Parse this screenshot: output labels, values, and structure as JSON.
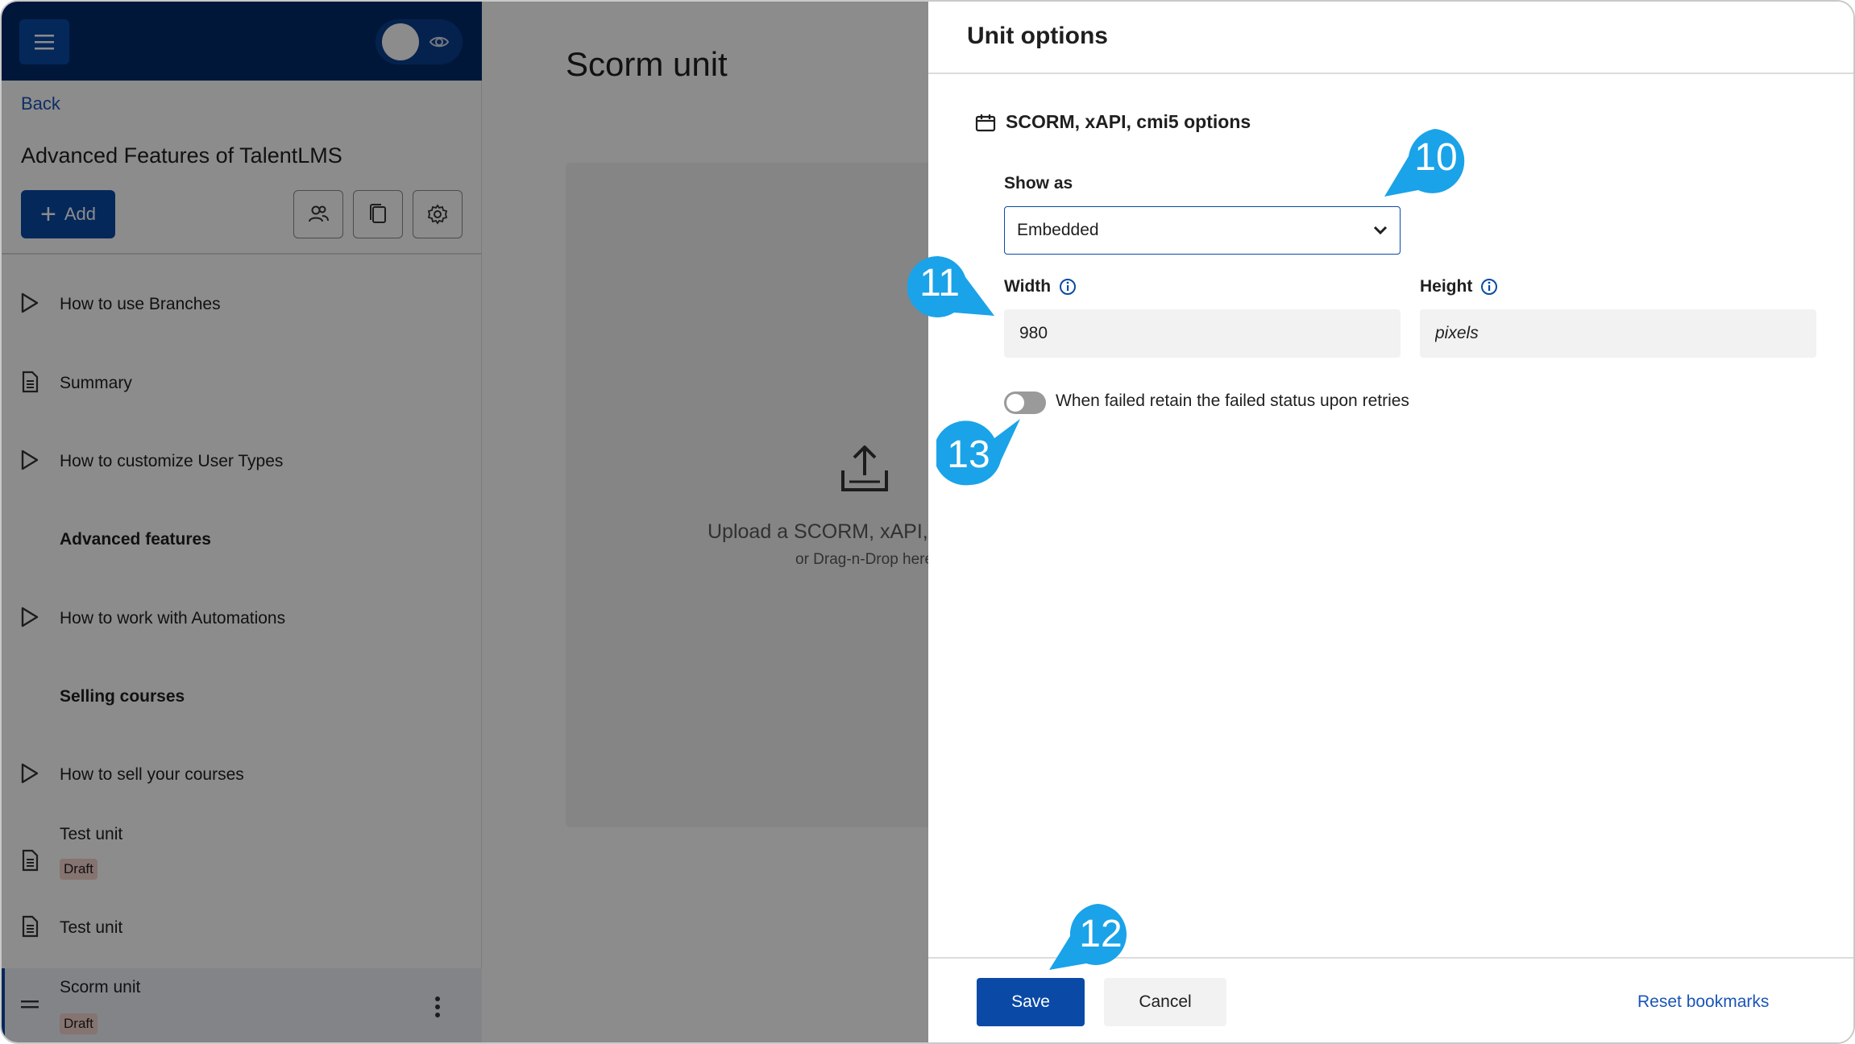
{
  "sidebar": {
    "back_label": "Back",
    "course_title": "Advanced Features of TalentLMS",
    "add_label": "Add",
    "items": [
      {
        "label": "How to use Branches",
        "icon": "play-icon"
      },
      {
        "label": "Summary",
        "icon": "document-icon"
      },
      {
        "label": "How to customize User Types",
        "icon": "play-icon"
      },
      {
        "label": "Advanced features",
        "type": "section"
      },
      {
        "label": "How to work with Automations",
        "icon": "play-icon"
      },
      {
        "label": "Selling courses",
        "type": "section"
      },
      {
        "label": "How to sell your courses",
        "icon": "play-icon"
      },
      {
        "label": "Test unit",
        "icon": "document-icon",
        "badge": "Draft"
      },
      {
        "label": "Test unit",
        "icon": "document-icon"
      },
      {
        "label": "Scorm unit",
        "icon": "drag-handle-icon",
        "badge": "Draft",
        "active": true
      }
    ]
  },
  "main": {
    "title": "Scorm unit",
    "upload_text": "Upload a SCORM, xAPI, c",
    "upload_sub": "or Drag-n-Drop here"
  },
  "drawer": {
    "title": "Unit options",
    "section_title": "SCORM, xAPI, cmi5 options",
    "show_as_label": "Show as",
    "show_as_value": "Embedded",
    "width_label": "Width",
    "width_value": "980",
    "height_label": "Height",
    "height_placeholder": "pixels",
    "toggle_label": "When failed retain the failed status upon retries",
    "toggle_on": false,
    "save_label": "Save",
    "cancel_label": "Cancel",
    "reset_label": "Reset bookmarks"
  },
  "callouts": {
    "c10": "10",
    "c11": "11",
    "c12": "12",
    "c13": "13"
  },
  "colors": {
    "primary": "#0a4aa6",
    "topbar": "#022a6a",
    "link": "#1a55b8",
    "callout": "#1aa3e8",
    "draft_badge": "#f5d3cc"
  }
}
